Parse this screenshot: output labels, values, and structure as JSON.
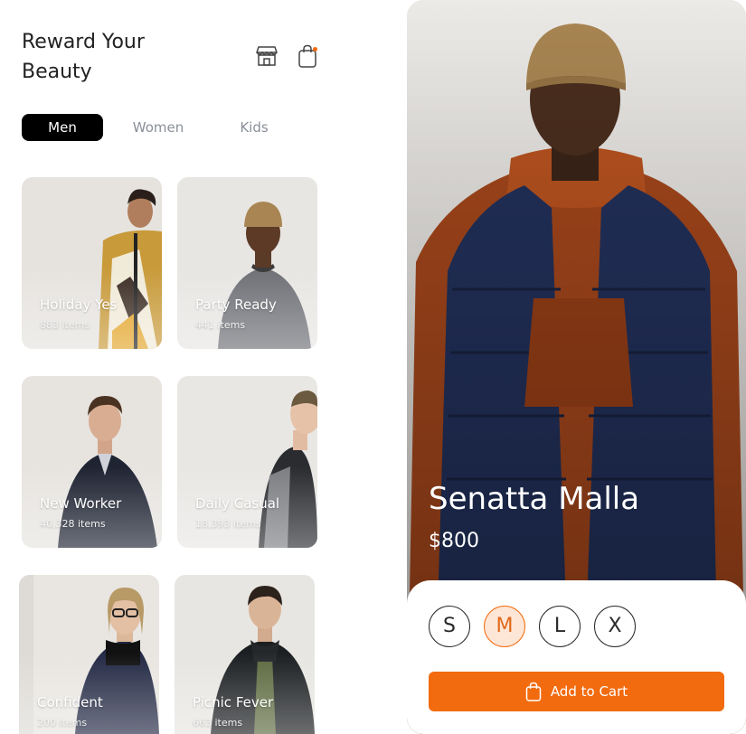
{
  "header": {
    "title": "Reward Your Beauty",
    "store_icon": "store-icon",
    "bag_icon": "shopping-bag-icon",
    "accent_color": "#f26b0f"
  },
  "tabs": [
    {
      "label": "Men",
      "active": true
    },
    {
      "label": "Women",
      "active": false
    },
    {
      "label": "Kids",
      "active": false
    }
  ],
  "categories": [
    {
      "name": "Holiday Yes",
      "count": "883 items"
    },
    {
      "name": "Party Ready",
      "count": "441 items"
    },
    {
      "name": "New Worker",
      "count": "40,328 items"
    },
    {
      "name": "Daily Casual",
      "count": "18,393 items"
    },
    {
      "name": "Confident",
      "count": "200 items"
    },
    {
      "name": "Picnic Fever",
      "count": "663 items"
    }
  ],
  "product": {
    "name": "Senatta Malla",
    "price": "$800",
    "sizes": [
      "S",
      "M",
      "L",
      "X"
    ],
    "selected_size": "M",
    "add_to_cart_label": "Add to Cart",
    "cart_icon": "shopping-bag-icon"
  }
}
